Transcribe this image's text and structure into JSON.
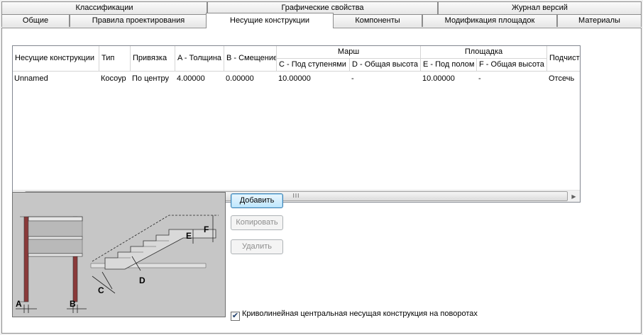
{
  "tabs_row1": [
    {
      "label": "Классификации"
    },
    {
      "label": "Графические свойства"
    },
    {
      "label": "Журнал версий"
    }
  ],
  "tabs_row2": [
    {
      "label": "Общие"
    },
    {
      "label": "Правила проектирования"
    },
    {
      "label": "Несущие конструкции"
    },
    {
      "label": "Компоненты"
    },
    {
      "label": "Модификация площадок"
    },
    {
      "label": "Материалы"
    }
  ],
  "active_tab": "Несущие конструкции",
  "grid": {
    "headers": {
      "name": "Несущие конструкции",
      "type": "Тип",
      "anchor": "Привязка",
      "a": "A - Толщина",
      "b": "B - Смещение",
      "group_flight": "Марш",
      "c": "C - Под ступенями",
      "d": "D - Общая высота",
      "group_landing": "Площадка",
      "e": "E - Под полом",
      "f": "F - Общая высота",
      "cut": "Подчист"
    },
    "rows": [
      {
        "name": "Unnamed",
        "type": "Косоур",
        "anchor": "По центру",
        "a": "4.00000",
        "b": "0.00000",
        "c": "10.00000",
        "d": "-",
        "e": "10.00000",
        "f": "-",
        "cut": "Отсечь"
      }
    ],
    "scroll_thumb_glyph": "III"
  },
  "diagram_labels": {
    "a": "A",
    "b": "B",
    "c": "C",
    "d": "D",
    "e": "E",
    "f": "F"
  },
  "buttons": {
    "add": "Добавить",
    "copy": "Копировать",
    "delete": "Удалить"
  },
  "checkbox": {
    "label": "Криволинейная центральная несущая конструкция на поворотах",
    "checked": true
  }
}
